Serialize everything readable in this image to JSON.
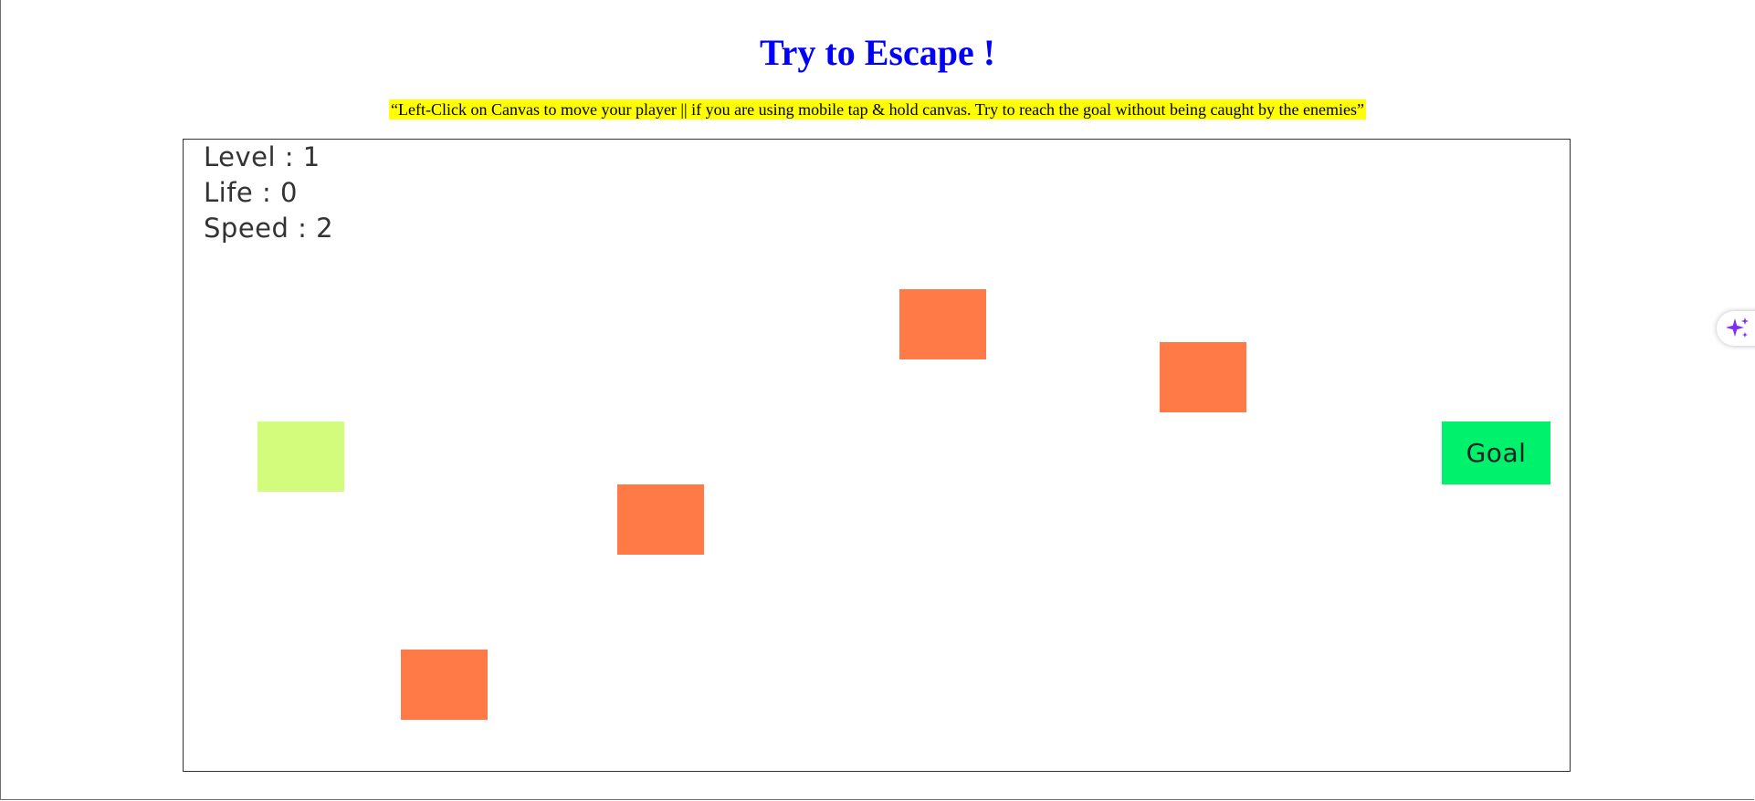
{
  "page": {
    "title": "Try to Escape !",
    "instructions": "“Left-Click on Canvas to move your player || if you are using mobile tap & hold canvas. Try to reach the goal without being caught by the enemies”"
  },
  "hud": {
    "level_label": "Level",
    "level_value": "1",
    "life_label": "Life",
    "life_value": "0",
    "speed_label": "Speed",
    "speed_value": "2",
    "separator": " : "
  },
  "game": {
    "goal_label": "Goal",
    "player_color": "#d4fc7c",
    "enemy_color": "#ff7a47",
    "goal_color": "#00f26c",
    "enemy_count": 4
  },
  "colors": {
    "title": "#0000ff",
    "highlight": "#ffff00",
    "ai_icon": "#7b2ff7"
  },
  "floating": {
    "icon": "sparkle-icon"
  }
}
